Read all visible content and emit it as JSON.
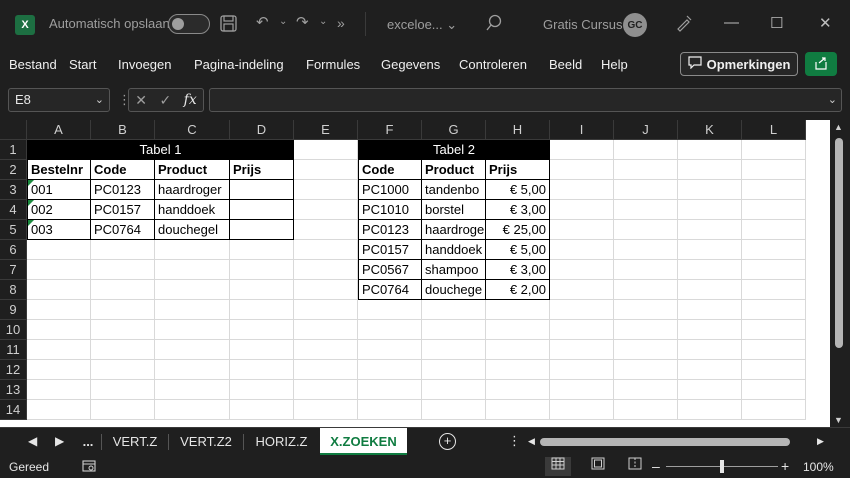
{
  "titlebar": {
    "app_letter": "X",
    "autosave_label": "Automatisch opslaan",
    "filename": "exceloe... ⌄",
    "more": "»",
    "user": "Gratis Cursus",
    "avatar_initials": "GC"
  },
  "menu": {
    "items": [
      "Bestand",
      "Start",
      "Invoegen",
      "Pagina-indeling",
      "Formules",
      "Gegevens",
      "Controleren",
      "Beeld",
      "Help"
    ],
    "comments_label": "Opmerkingen"
  },
  "formula_bar": {
    "name_box": "E8",
    "fx_label": "fx",
    "formula_value": ""
  },
  "columns": [
    "A",
    "B",
    "C",
    "D",
    "E",
    "F",
    "G",
    "H",
    "I",
    "J",
    "K",
    "L"
  ],
  "rows": [
    "1",
    "2",
    "3",
    "4",
    "5",
    "6",
    "7",
    "8",
    "9",
    "10",
    "11",
    "12",
    "13",
    "14"
  ],
  "table1": {
    "title": "Tabel 1",
    "headers": [
      "Bestelnr",
      "Code",
      "Product",
      "Prijs"
    ],
    "rows": [
      [
        "001",
        "PC0123",
        "haardroger",
        ""
      ],
      [
        "002",
        "PC0157",
        "handdoek",
        ""
      ],
      [
        "003",
        "PC0764",
        "douchegel",
        ""
      ]
    ]
  },
  "table2": {
    "title": "Tabel 2",
    "headers": [
      "Code",
      "Product",
      "Prijs"
    ],
    "rows": [
      [
        "PC1000",
        "tandenbo",
        "€ 5,00"
      ],
      [
        "PC1010",
        "borstel",
        "€ 3,00"
      ],
      [
        "PC0123",
        "haardroge",
        "€ 25,00"
      ],
      [
        "PC0157",
        "handdoek",
        "€ 5,00"
      ],
      [
        "PC0567",
        "shampoo",
        "€ 3,00"
      ],
      [
        "PC0764",
        "douchege",
        "€ 2,00"
      ]
    ]
  },
  "sheet_tabs": {
    "ellipsis": "...",
    "tabs": [
      "VERT.Z",
      "VERT.Z2",
      "HORIZ.Z",
      "X.ZOEKEN"
    ],
    "active": "X.ZOEKEN"
  },
  "status": {
    "text": "Gereed",
    "zoom": "100%",
    "zoom_fraction": 0.5
  },
  "colors": {
    "accent": "#107c41",
    "background": "#1f1f1f",
    "table_header": "#000000"
  }
}
